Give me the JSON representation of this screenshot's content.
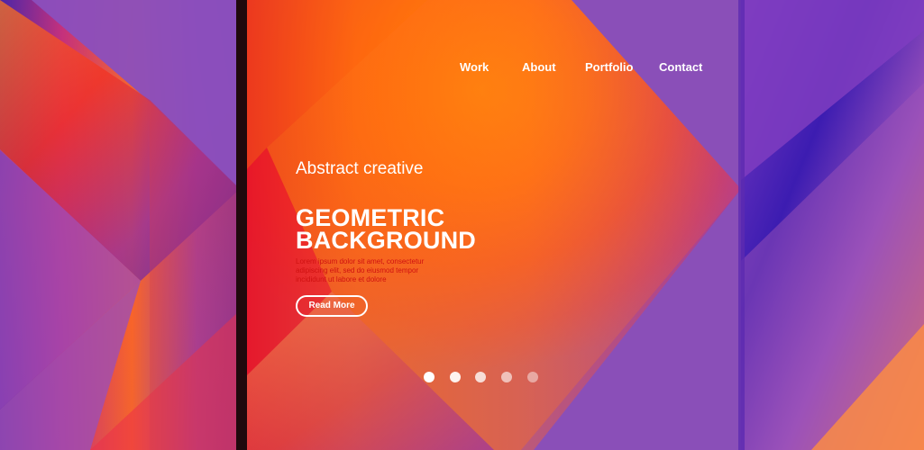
{
  "nav": {
    "items": [
      {
        "label": "Work"
      },
      {
        "label": "About"
      },
      {
        "label": "Portfolio"
      },
      {
        "label": "Contact"
      }
    ]
  },
  "hero": {
    "kicker": "Abstract creative",
    "title_line_1": "GEOMETRIC",
    "title_line_2": "BACKGROUND",
    "body": "Lorem ipsum dolor sit amet, consectetur adipiscing elit, sed do eiusmod tempor incididunt ut labore et dolore",
    "cta_label": "Read More"
  },
  "carousel": {
    "slides": 5,
    "active_index": 0
  },
  "colors": {
    "background_purple": "#8a4fb8",
    "accent_orange": "#ff8a00",
    "accent_red": "#e3263c",
    "accent_indigo": "#4a24a8",
    "text_primary": "#ffffff",
    "body_text_red": "#cf1111"
  }
}
